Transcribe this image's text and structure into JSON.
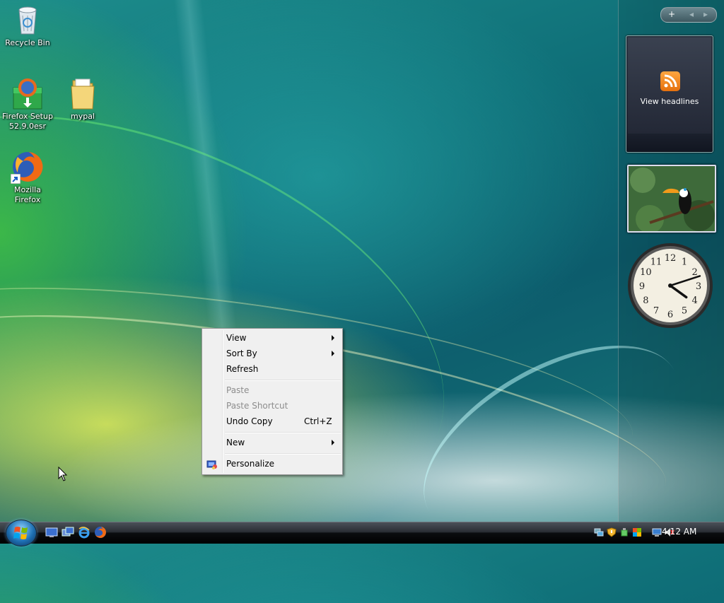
{
  "desktop": {
    "icons": [
      {
        "label": "Recycle Bin"
      },
      {
        "label": "Firefox Setup 52.9.0esr"
      },
      {
        "label": "mypal"
      },
      {
        "label": "Mozilla Firefox"
      }
    ]
  },
  "sidebar": {
    "add_label": "+",
    "prev_label": "◂",
    "next_label": "▸",
    "feed_label": "View headlines"
  },
  "clock": {
    "hour": 4,
    "minute": 12
  },
  "context_menu": {
    "items": [
      {
        "label": "View",
        "submenu": true
      },
      {
        "label": "Sort By",
        "submenu": true
      },
      {
        "label": "Refresh"
      },
      {
        "label": "Paste",
        "disabled": true
      },
      {
        "label": "Paste Shortcut",
        "disabled": true
      },
      {
        "label": "Undo Copy",
        "shortcut": "Ctrl+Z"
      },
      {
        "label": "New",
        "submenu": true
      },
      {
        "label": "Personalize"
      }
    ]
  },
  "taskbar": {
    "quick_launch": [
      "show-desktop-icon",
      "switch-windows-icon",
      "internet-explorer-icon",
      "firefox-icon"
    ],
    "tray_icons": [
      "network-icon",
      "security-icon",
      "safely-remove-icon",
      "windows-update-icon",
      "display-icon",
      "volume-muted-icon"
    ],
    "time": "4:12 AM"
  }
}
